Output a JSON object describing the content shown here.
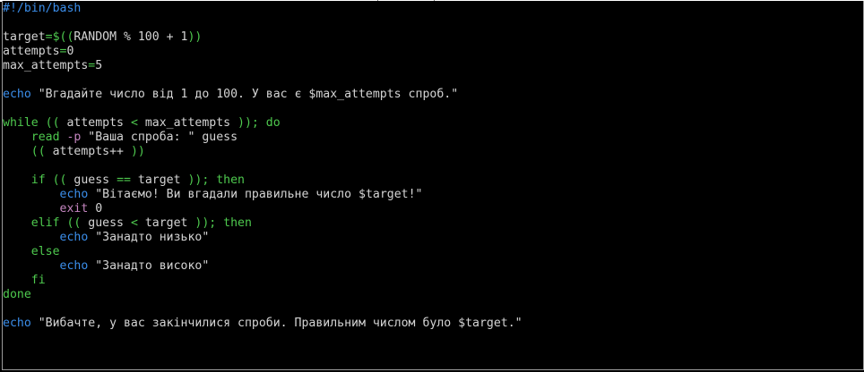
{
  "editor": {
    "lines": [
      [
        {
          "t": "#!/bin/bash",
          "k": "comment"
        }
      ],
      [],
      [
        {
          "t": "target",
          "k": "var"
        },
        {
          "t": "=$((",
          "k": "op"
        },
        {
          "t": "RANDOM % 100 + 1",
          "k": "expr"
        },
        {
          "t": "))",
          "k": "op"
        }
      ],
      [
        {
          "t": "attempts",
          "k": "var"
        },
        {
          "t": "=",
          "k": "op"
        },
        {
          "t": "0",
          "k": "num"
        }
      ],
      [
        {
          "t": "max_attempts",
          "k": "var"
        },
        {
          "t": "=",
          "k": "op"
        },
        {
          "t": "5",
          "k": "num"
        }
      ],
      [],
      [
        {
          "t": "echo",
          "k": "builtin"
        },
        {
          "t": " \"Вгадайте число від 1 до 100. У вас є $max_attempts спроб.\"",
          "k": "string"
        }
      ],
      [],
      [
        {
          "t": "while",
          "k": "keyword"
        },
        {
          "t": " (( ",
          "k": "op"
        },
        {
          "t": "attempts",
          "k": "plain"
        },
        {
          "t": " < ",
          "k": "op"
        },
        {
          "t": "max_attempts",
          "k": "plain"
        },
        {
          "t": " )); do",
          "k": "keyword"
        }
      ],
      [
        {
          "t": "    ",
          "k": "plain"
        },
        {
          "t": "read",
          "k": "keyword"
        },
        {
          "t": " -p",
          "k": "flag"
        },
        {
          "t": " \"Ваша спроба: \" guess",
          "k": "string"
        }
      ],
      [
        {
          "t": "    ",
          "k": "plain"
        },
        {
          "t": "(( ",
          "k": "op"
        },
        {
          "t": "attempts++",
          "k": "plain"
        },
        {
          "t": " ))",
          "k": "op"
        }
      ],
      [],
      [
        {
          "t": "    ",
          "k": "plain"
        },
        {
          "t": "if",
          "k": "keyword"
        },
        {
          "t": " (( ",
          "k": "op"
        },
        {
          "t": "guess",
          "k": "plain"
        },
        {
          "t": " == ",
          "k": "op"
        },
        {
          "t": "target",
          "k": "plain"
        },
        {
          "t": " )); then",
          "k": "keyword"
        }
      ],
      [
        {
          "t": "        ",
          "k": "plain"
        },
        {
          "t": "echo",
          "k": "builtin"
        },
        {
          "t": " \"Вітаємо! Ви вгадали правильне число $target!\"",
          "k": "string"
        }
      ],
      [
        {
          "t": "        ",
          "k": "plain"
        },
        {
          "t": "exit",
          "k": "exit"
        },
        {
          "t": " 0",
          "k": "num"
        }
      ],
      [
        {
          "t": "    ",
          "k": "plain"
        },
        {
          "t": "elif",
          "k": "keyword"
        },
        {
          "t": " (( ",
          "k": "op"
        },
        {
          "t": "guess",
          "k": "plain"
        },
        {
          "t": " < ",
          "k": "op"
        },
        {
          "t": "target",
          "k": "plain"
        },
        {
          "t": " )); then",
          "k": "keyword"
        }
      ],
      [
        {
          "t": "        ",
          "k": "plain"
        },
        {
          "t": "echo",
          "k": "builtin"
        },
        {
          "t": " \"Занадто низько\"",
          "k": "string"
        }
      ],
      [
        {
          "t": "    ",
          "k": "plain"
        },
        {
          "t": "else",
          "k": "keyword"
        }
      ],
      [
        {
          "t": "        ",
          "k": "plain"
        },
        {
          "t": "echo",
          "k": "builtin"
        },
        {
          "t": " \"Занадто високо\"",
          "k": "string"
        }
      ],
      [
        {
          "t": "    ",
          "k": "plain"
        },
        {
          "t": "fi",
          "k": "keyword"
        }
      ],
      [
        {
          "t": "done",
          "k": "keyword"
        }
      ],
      [],
      [
        {
          "t": "echo",
          "k": "builtin"
        },
        {
          "t": " \"Вибачте, у вас закінчилися спроби. Правильним числом було $target.\"",
          "k": "string"
        }
      ]
    ]
  },
  "colors": {
    "background": "#000000",
    "default_text": "#d4d4d4",
    "keyword": "#4ec94e",
    "builtin": "#3b8eea",
    "flag": "#c586c0"
  }
}
